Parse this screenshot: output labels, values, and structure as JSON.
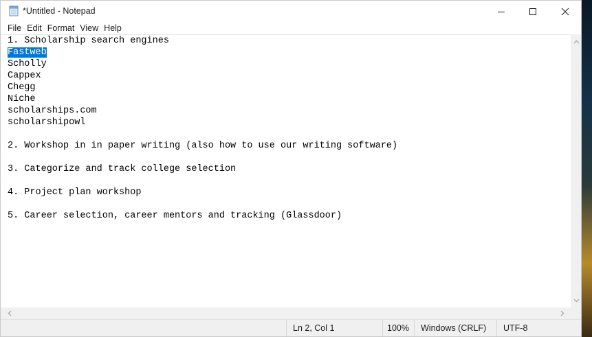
{
  "window": {
    "title": "*Untitled - Notepad",
    "app_icon": "notepad-icon"
  },
  "controls": {
    "minimize_icon": "minimize-icon",
    "maximize_icon": "maximize-icon",
    "close_icon": "close-icon"
  },
  "menu": {
    "items": [
      {
        "label": "File"
      },
      {
        "label": "Edit"
      },
      {
        "label": "Format"
      },
      {
        "label": "View"
      },
      {
        "label": "Help"
      }
    ]
  },
  "editor": {
    "lines": [
      "1. Scholarship search engines",
      "Fastweb",
      "Scholly",
      "Cappex",
      "Chegg",
      "Niche",
      "scholarships.com",
      "scholarshipowl",
      "",
      "2. Workshop in in paper writing (also how to use our writing software)",
      "",
      "3. Categorize and track college selection",
      "",
      "4. Project plan workshop",
      "",
      "5. Career selection, career mentors and tracking (Glassdoor)"
    ],
    "selected_line_index": 1,
    "selection_color": "#0078d7"
  },
  "status": {
    "position": "Ln 2, Col 1",
    "zoom": "100%",
    "line_endings": "Windows (CRLF)",
    "encoding": "UTF-8"
  }
}
